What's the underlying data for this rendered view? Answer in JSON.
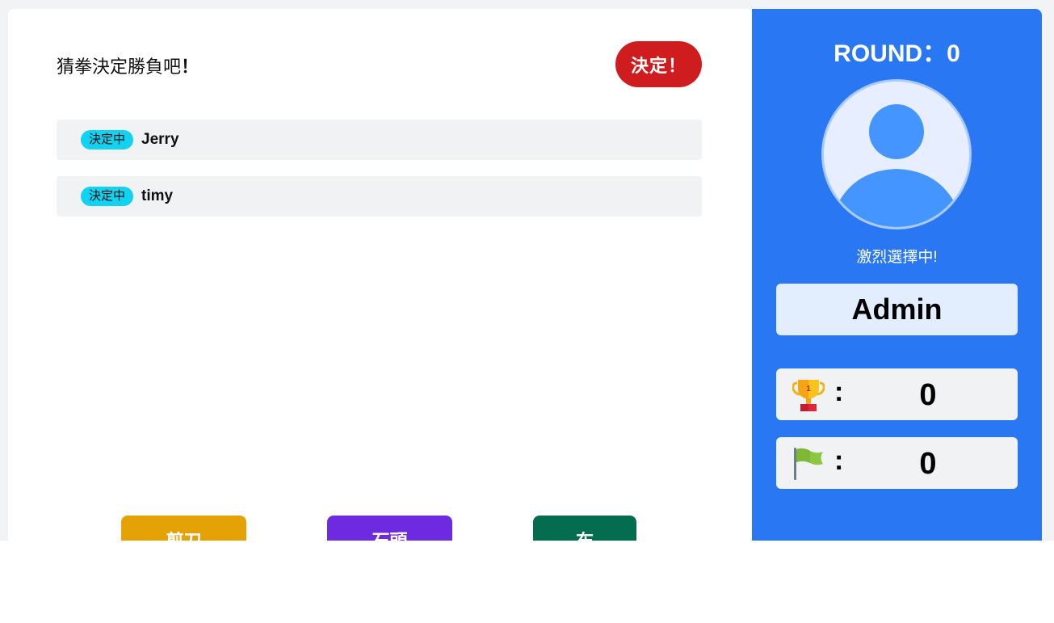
{
  "main": {
    "header_title": "猜拳決定勝負吧",
    "header_bang": "！",
    "decide_button": "決定！",
    "players": [
      {
        "status": "決定中",
        "name": "Jerry"
      },
      {
        "status": "決定中",
        "name": "timy"
      }
    ],
    "choices": [
      {
        "label": "剪刀",
        "color": "#e4a206"
      },
      {
        "label": "石頭",
        "color": "#6d2ae0"
      },
      {
        "label": "布",
        "color": "#046d50"
      }
    ]
  },
  "sidebar": {
    "round_text": "ROUND：0",
    "avatar_icon": "user-avatar-icon",
    "status_text": "激烈選擇中!",
    "username": "Admin",
    "stats": [
      {
        "icon": "trophy-icon",
        "colon": ":",
        "value": "0"
      },
      {
        "icon": "flag-icon",
        "colon": ":",
        "value": "0"
      }
    ]
  },
  "colors": {
    "accent": "#2a77f3",
    "decide": "#cf1c1f",
    "badge": "#12d2f1"
  }
}
